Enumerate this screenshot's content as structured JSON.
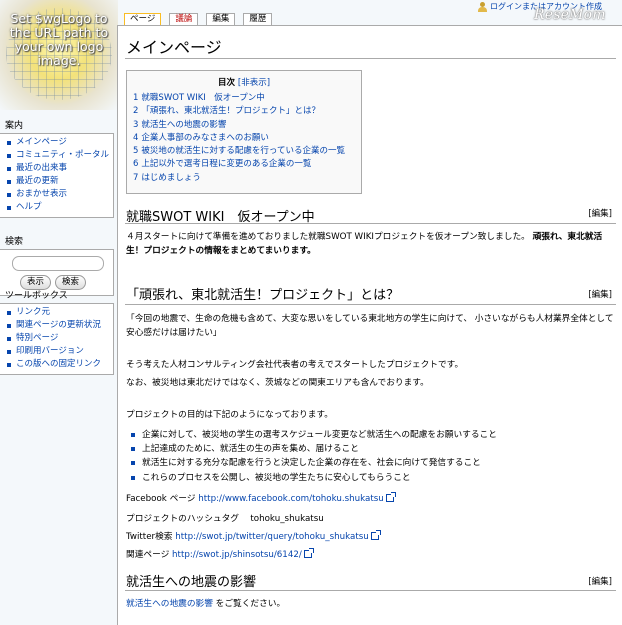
{
  "logo": {
    "text": "Set $wgLogo to the URL path to your own logo image."
  },
  "watermark": "ReseMom",
  "personal": {
    "login": "ログインまたはアカウント作成"
  },
  "tabs": [
    {
      "label": "ページ",
      "state": "selected"
    },
    {
      "label": "議論",
      "state": "new"
    },
    {
      "label": "編集",
      "state": "normal"
    },
    {
      "label": "履歴",
      "state": "normal"
    }
  ],
  "sidebar": {
    "navigation": {
      "title": "案内",
      "items": [
        "メインページ",
        "コミュニティ・ポータル",
        "最近の出来事",
        "最近の更新",
        "おまかせ表示",
        "ヘルプ"
      ]
    },
    "search": {
      "title": "検索",
      "buttons": [
        "表示",
        "検索"
      ]
    },
    "toolbox": {
      "title": "ツールボックス",
      "items": [
        "リンク元",
        "関連ページの更新状況",
        "特別ページ",
        "印刷用バージョン",
        "この版への固定リンク"
      ]
    }
  },
  "content": {
    "title": "メインページ",
    "toc": {
      "title": "目次",
      "toggle": "[非表示]",
      "items": [
        {
          "num": "1",
          "label": "就職SWOT WIKI　仮オープン中"
        },
        {
          "num": "2",
          "label": "「頑張れ、東北就活生！プロジェクト」とは？"
        },
        {
          "num": "3",
          "label": "就活生への地震の影響"
        },
        {
          "num": "4",
          "label": "企業人事部のみなさまへのお願い"
        },
        {
          "num": "5",
          "label": "被災地の就活生に対する配慮を行っている企業の一覧"
        },
        {
          "num": "6",
          "label": "上記以外で選考日程に変更のある企業の一覧"
        },
        {
          "num": "7",
          "label": "はじめましょう"
        }
      ]
    },
    "edit_label": "[編集]",
    "sections": [
      {
        "heading": "就職SWOT WIKI　仮オープン中",
        "para1": "４月スタートに向けて準備を進めておりました就職SWOT WIKIプロジェクトを仮オープン致しました。",
        "para1_bold": "頑張れ、東北就活生！プロジェクトの情報をまとめてまいります。"
      },
      {
        "heading": "「頑張れ、東北就活生！プロジェクト」とは？",
        "quote": "「今回の地震で、生命の危機も含めて、大変な思いをしている東北地方の学生に向けて、 小さいながらも人材業界全体として安心感だけは届けたい」",
        "origin": "そう考えた人材コンサルティング会社代表者の考えでスタートしたプロジェクトです。",
        "area": "なお、被災地は東北だけではなく、茨城などの関東エリアも含んでおります。",
        "purpose": "プロジェクトの目的は下記のようになっております。",
        "bullets": [
          "企業に対して、被災地の学生の選考スケジュール変更など就活生への配慮をお願いすること",
          "上記達成のために、就活生の生の声を集め、届けること",
          "就活生に対する充分な配慮を行うと決定した企業の存在を、社会に向けて発信すること",
          "これらのプロセスを公開し、被災地の学生たちに安心してもらうこと"
        ],
        "facebook_label": "Facebook ページ",
        "facebook_url": "http://www.facebook.com/tohoku.shukatsu",
        "hashtag_label": "プロジェクトのハッシュタグ",
        "hashtag": "tohoku_shukatsu",
        "twitter_label": "Twitter検索",
        "twitter_url": "http://swot.jp/twitter/query/tohoku_shukatsu",
        "related_label": "関連ページ",
        "related_url": "http://swot.jp/shinsotsu/6142/"
      },
      {
        "heading": "就活生への地震の影響",
        "link": "就活生への地震の影響",
        "suffix": "をご覧ください。"
      }
    ]
  }
}
